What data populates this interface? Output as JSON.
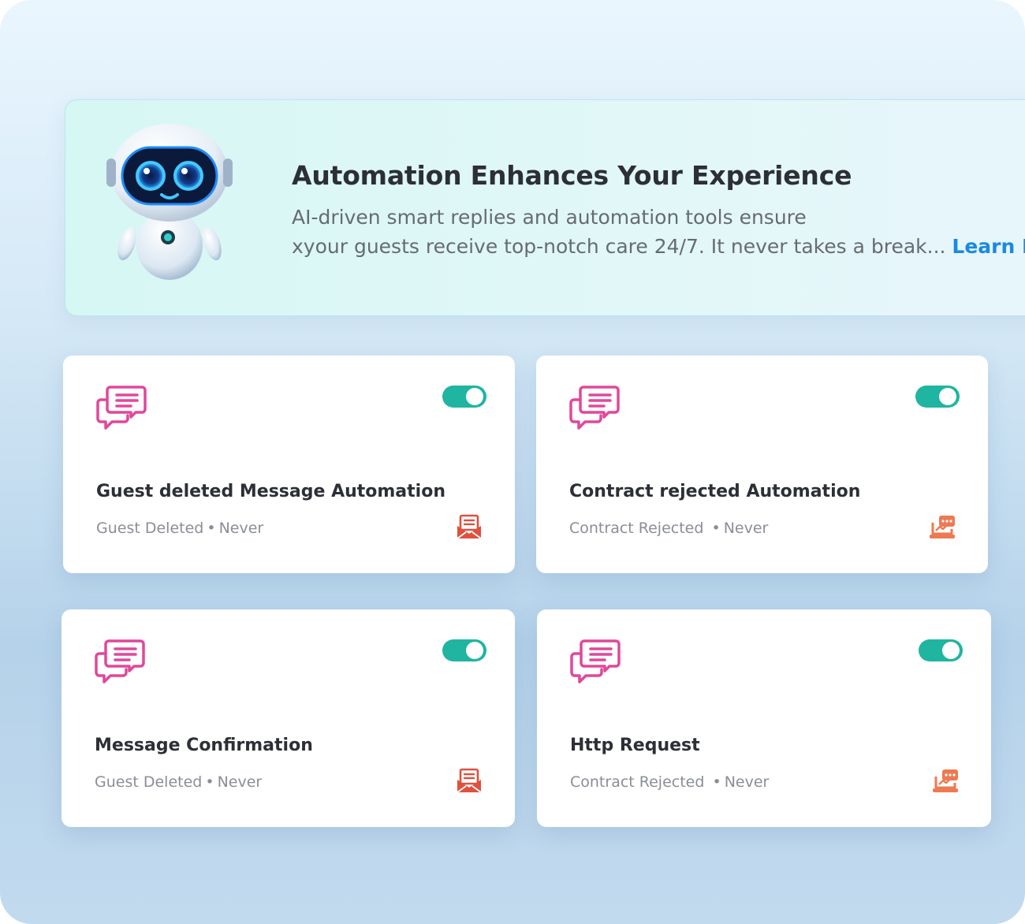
{
  "banner": {
    "title": "Automation Enhances Your Experience",
    "line1": "AI-driven smart replies and automation tools ensure",
    "line2": "xyour guests receive top-notch care 24/7. It never takes a break... ",
    "learn": "Learn More"
  },
  "cards": [
    {
      "title": "Guest deleted Message Automation",
      "trigger": "Guest Deleted",
      "sep": "•",
      "when": "Never",
      "type_icon": "mail-icon",
      "enabled": true
    },
    {
      "title": "Contract rejected Automation",
      "trigger": "Contract Rejected ",
      "sep": "•",
      "when": "Never",
      "type_icon": "laptop-chat-icon",
      "enabled": true
    },
    {
      "title": "Message Confirmation",
      "trigger": "Guest Deleted",
      "sep": "•",
      "when": "Never",
      "type_icon": "mail-icon",
      "enabled": true
    },
    {
      "title": "Http Request",
      "trigger": "Contract Rejected ",
      "sep": "•",
      "when": "Never",
      "type_icon": "laptop-chat-icon",
      "enabled": true
    }
  ],
  "colors": {
    "accent_toggle": "#1fb5a0",
    "icon_pink": "#e0489a",
    "mail_red": "#e0503c",
    "laptop_orange": "#ee7a52",
    "link_blue": "#1a8ae0"
  }
}
